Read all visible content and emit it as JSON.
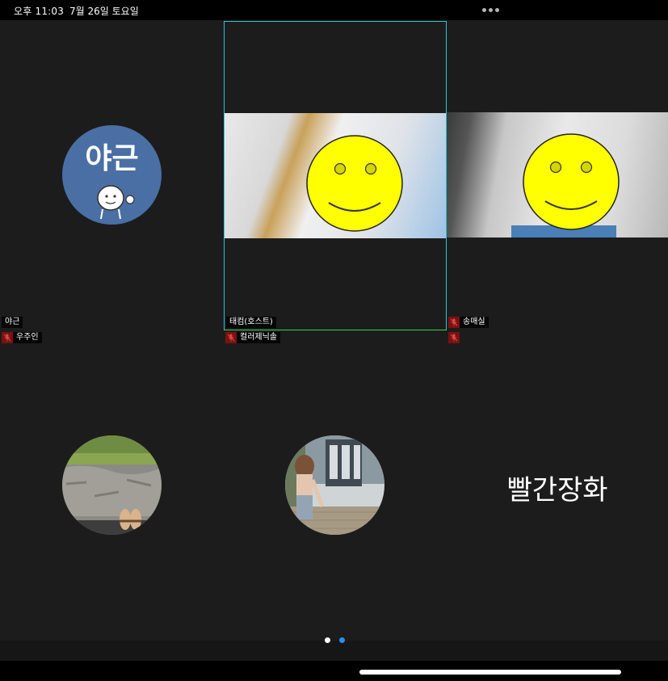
{
  "status_bar": {
    "time": "오후 11:03",
    "date": "7월 26일 토요일"
  },
  "colors": {
    "background": "#1c1c1c",
    "active_speaker_border": "#39d353",
    "pinned_border": "#2bc4d9",
    "muted_icon_bg": "#7a1212",
    "avatar_blue": "#4a6fa5",
    "page_dot_active": "#2d8cf0",
    "page_dot_inactive": "#ffffff"
  },
  "participants": [
    {
      "name": "야근",
      "muted": false,
      "avatar_text": "야근",
      "avatar_icon": "cartoon-thumbs-up-icon"
    },
    {
      "name": "우주인",
      "muted": true,
      "avatar_icon": "landscape-feet-photo"
    },
    {
      "name": "태컴(호스트)",
      "muted": false,
      "video": "face-covered-by-smiley"
    },
    {
      "name": "컬러제닉솔",
      "muted": true,
      "avatar_icon": "person-walking-photo"
    },
    {
      "name": "송매실",
      "muted": true,
      "video": "face-covered-by-smiley"
    },
    {
      "name": "빨간장화",
      "muted": true,
      "avatar_text": "빨간장화"
    }
  ],
  "pagination": {
    "current": 2,
    "total": 2
  }
}
